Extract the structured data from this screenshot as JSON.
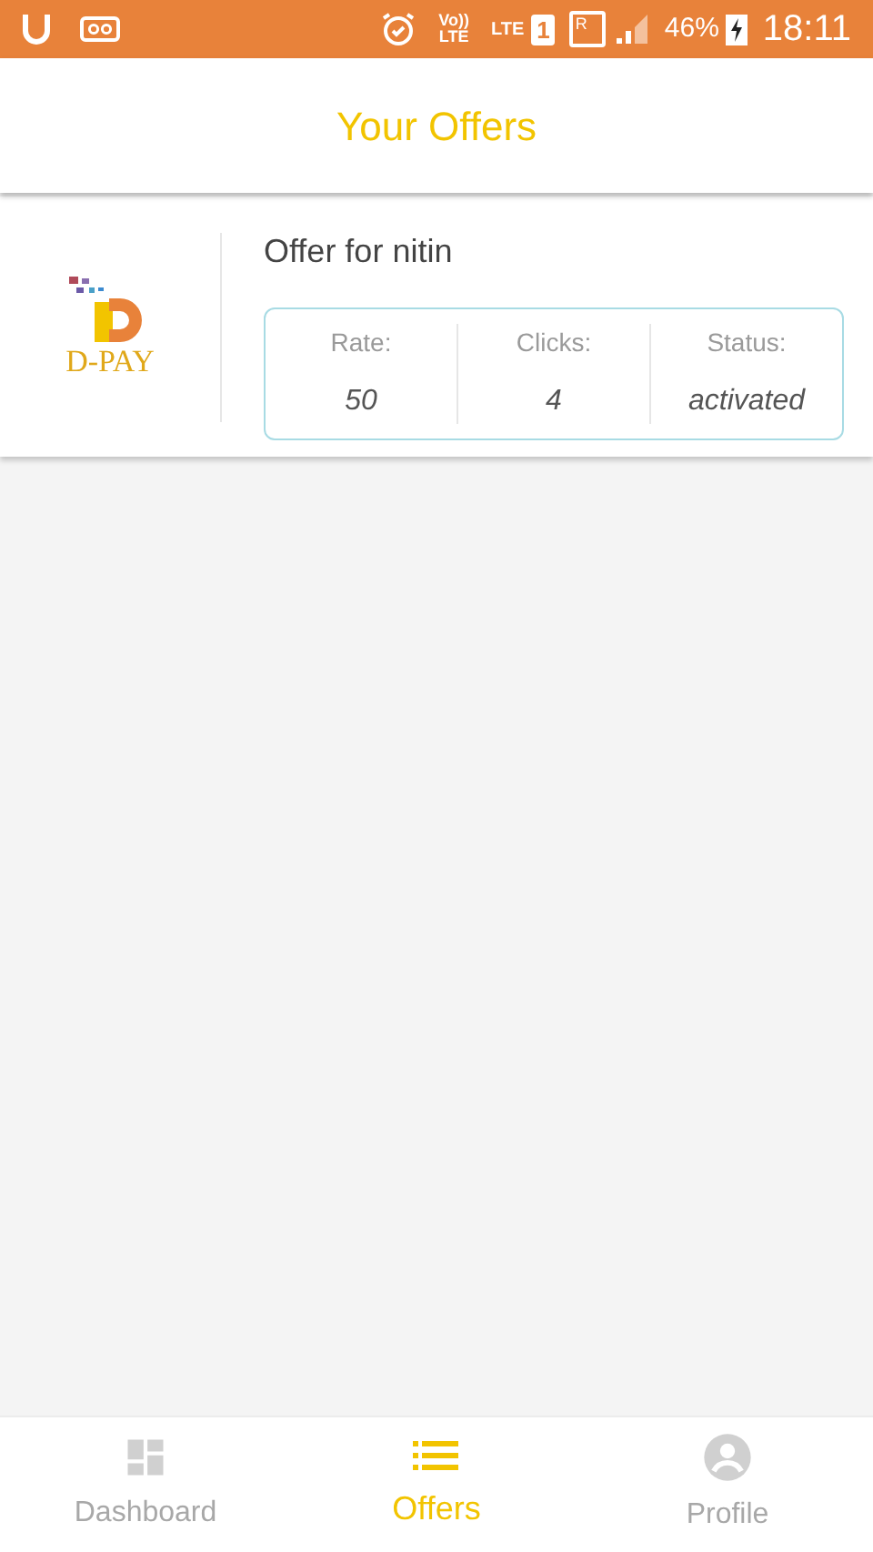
{
  "status_bar": {
    "volte": "Vo))",
    "volte_sub": "LTE",
    "lte": "LTE",
    "sim": "1",
    "roaming": "R",
    "battery": "46%",
    "time": "18:11"
  },
  "header": {
    "title": "Your Offers"
  },
  "offers": [
    {
      "logo_text": "D-PAY",
      "title": "Offer for nitin",
      "stats": [
        {
          "label": "Rate:",
          "value": "50"
        },
        {
          "label": "Clicks:",
          "value": "4"
        },
        {
          "label": "Status:",
          "value": "activated"
        }
      ]
    }
  ],
  "bottom_nav": [
    {
      "label": "Dashboard",
      "kind": "dashboard",
      "selected": false
    },
    {
      "label": "Offers",
      "kind": "list",
      "selected": true
    },
    {
      "label": "Profile",
      "kind": "profile",
      "selected": false
    }
  ]
}
